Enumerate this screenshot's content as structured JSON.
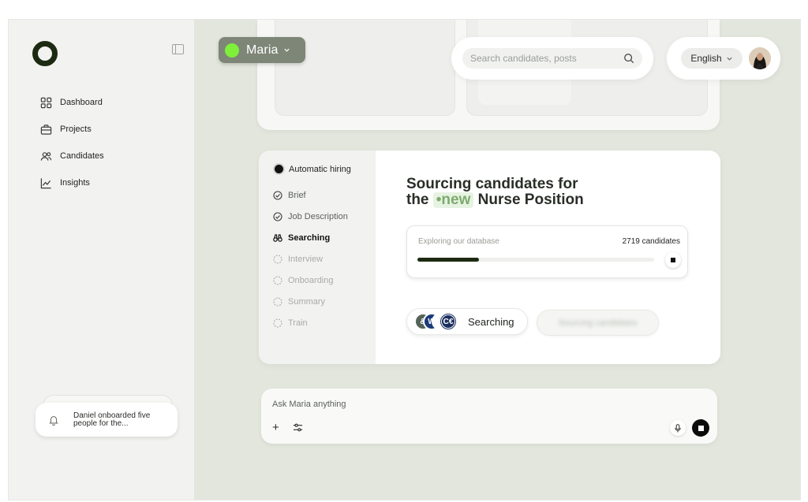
{
  "sidebar": {
    "items": [
      {
        "label": "Dashboard",
        "icon": "grid-icon"
      },
      {
        "label": "Projects",
        "icon": "briefcase-icon"
      },
      {
        "label": "Candidates",
        "icon": "users-icon"
      },
      {
        "label": "Insights",
        "icon": "chart-line-icon"
      }
    ],
    "notification": {
      "text": "Daniel onboarded five people for the..."
    }
  },
  "header": {
    "agent_name": "Maria",
    "agent_color": "#7ef03a",
    "search_placeholder": "Search candidates, posts",
    "language": "English"
  },
  "hiring": {
    "mode": "Automatic hiring",
    "steps": [
      {
        "label": "Brief",
        "state": "done"
      },
      {
        "label": "Job Description",
        "state": "done"
      },
      {
        "label": "Searching",
        "state": "active"
      },
      {
        "label": "Interview",
        "state": "pending"
      },
      {
        "label": "Onboarding",
        "state": "pending"
      },
      {
        "label": "Summary",
        "state": "pending"
      },
      {
        "label": "Train",
        "state": "pending"
      }
    ],
    "title_line1": "Sourcing candidates for",
    "title_the": "the",
    "title_badge": "•new",
    "title_rest": "Nurse Position",
    "explore_label": "Exploring our database",
    "candidates_count": "2719 candidates",
    "progress": 0.26,
    "status_label": "Searching",
    "blurred_action": "Sourcing candidates"
  },
  "ask": {
    "placeholder": "Ask Maria anything"
  },
  "colors": {
    "accent_dark": "#1d2a12",
    "new_badge_text": "#7dac6e",
    "main_bg": "#e3e6dd"
  }
}
